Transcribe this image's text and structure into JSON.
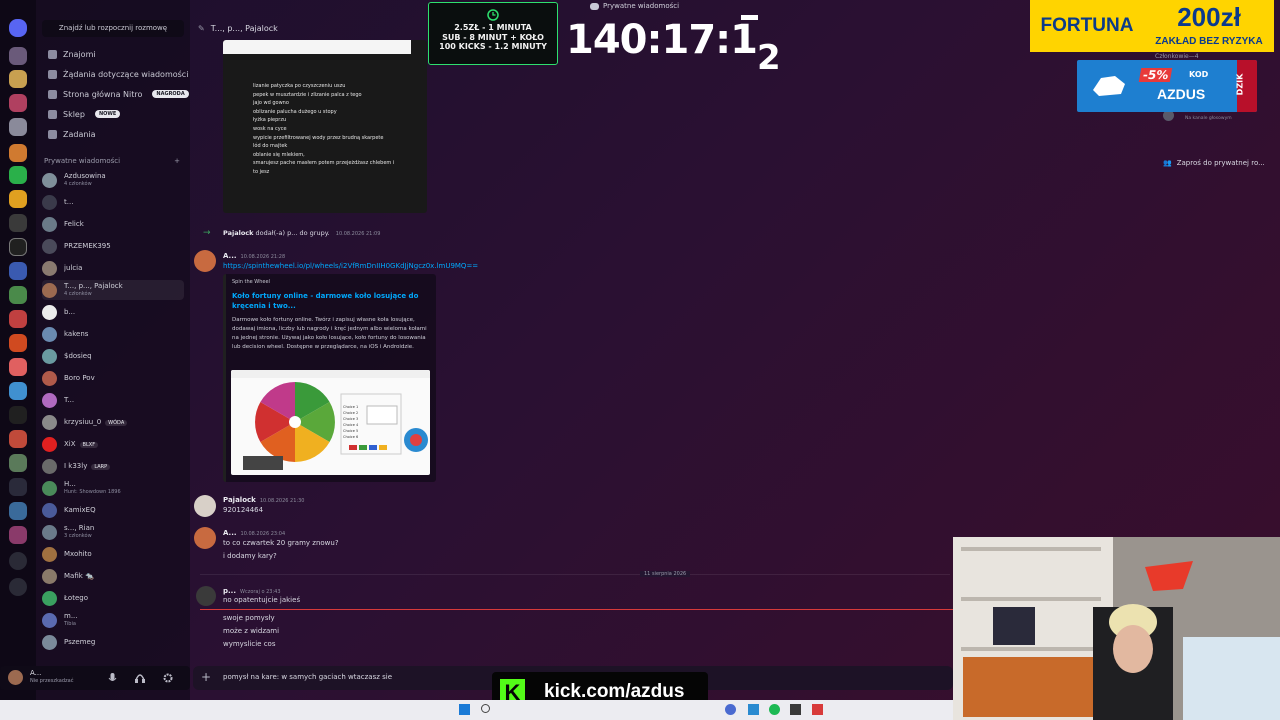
{
  "top_bar": {
    "title": "Prywatne wiadomości"
  },
  "dm_sidebar": {
    "search": "Znajdź lub rozpocznij rozmowę",
    "nav": [
      {
        "label": "Znajomi",
        "icon": "friends-icon",
        "badge": ""
      },
      {
        "label": "Żądania dotyczące wiadomości",
        "icon": "envelope-icon",
        "badge": ""
      },
      {
        "label": "Strona główna Nitro",
        "icon": "nitro-icon",
        "badge": "NAGRODA"
      },
      {
        "label": "Sklep",
        "icon": "shop-icon",
        "badge": "NOWE"
      },
      {
        "label": "Zadania",
        "icon": "tasks-icon",
        "badge": ""
      }
    ],
    "section_title": "Prywatne wiadomości",
    "section_add": "+",
    "dms": [
      {
        "name": "Azdusowina",
        "sub": "4 członków",
        "tag": "",
        "color": "#7f8f9a"
      },
      {
        "name": "t...",
        "sub": "",
        "tag": "",
        "color": "#3a3a4a"
      },
      {
        "name": "Felick",
        "sub": "",
        "tag": "",
        "color": "#6a7a88"
      },
      {
        "name": "PRZEMEK395",
        "sub": "",
        "tag": "",
        "color": "#4a4a5a"
      },
      {
        "name": "julcia",
        "sub": "",
        "tag": "",
        "color": "#8a7a70"
      },
      {
        "name": "T..., p..., Pajalock",
        "sub": "4 członków",
        "tag": "",
        "color": "#9c6a50",
        "selected": true
      },
      {
        "name": "b...",
        "sub": "",
        "tag": "",
        "color": "#ececec"
      },
      {
        "name": "kakens",
        "sub": "",
        "tag": "",
        "color": "#6a8ab0"
      },
      {
        "name": "$dosieq",
        "sub": "",
        "tag": "",
        "color": "#6a9aa0"
      },
      {
        "name": "Boro Pov",
        "sub": "",
        "tag": "",
        "color": "#b05a4a"
      },
      {
        "name": "T...",
        "sub": "",
        "tag": "",
        "color": "#b06ac0"
      },
      {
        "name": "krzysiuu_0",
        "sub": "",
        "tag": "WÓDA",
        "color": "#8a8a8a"
      },
      {
        "name": "XiX",
        "sub": "",
        "tag": "BLXF",
        "color": "#e02020"
      },
      {
        "name": "I k33ly",
        "sub": "",
        "tag": "LARP",
        "color": "#6a6a6a"
      },
      {
        "name": "H...",
        "sub": "Hunt: Showdown 1896",
        "tag": "",
        "color": "#4a8a5a"
      },
      {
        "name": "KamixEQ",
        "sub": "",
        "tag": "",
        "color": "#4a5a9a"
      },
      {
        "name": "s..., Rian",
        "sub": "3 członków",
        "tag": "",
        "color": "#6a7a8a"
      },
      {
        "name": "Mxohito",
        "sub": "",
        "tag": "",
        "color": "#a07040"
      },
      {
        "name": "Mafik 🐀",
        "sub": "",
        "tag": "",
        "color": "#8a7a6a"
      },
      {
        "name": "Łotego",
        "sub": "",
        "tag": "",
        "color": "#3aa060"
      },
      {
        "name": "m...",
        "sub": "Tibia",
        "tag": "",
        "color": "#5a6ab0"
      },
      {
        "name": "Pszemeg",
        "sub": "",
        "tag": "",
        "color": "#7a8a9a"
      }
    ],
    "user": {
      "name": "A...",
      "status": "Nie przeszkadzać"
    }
  },
  "chat": {
    "header_title": "T..., p..., Pajalock",
    "image_lines": [
      "lizanie patyczka po czyszczeniu uszu",
      "pepek w musztardzie i zlizanie palca z tego",
      "jajo wd gowno",
      "oblizanie palucha dużego u stopy",
      "łyżka pieprzu",
      "wosk na cyce",
      "wypicie przefiltrowanej wody przez brudną skarpete",
      "lód do majtek",
      "oblanie się mlekiem,",
      "smarujesz pache masłem potem przejeżdżasz chlebem i",
      "to jesz"
    ],
    "system_msg": {
      "actor": "Pajalock",
      "text": "dodał(-a) p...",
      "suffix": "do grupy.",
      "time": "10.08.2026 21:09"
    },
    "msg1": {
      "author": "A...",
      "time": "10.08.2026 21:28",
      "link": "https://spinthewheel.io/pl/wheels/i2VfRmDnIIH0GKdJjNgcz0x.lmU9MQ=="
    },
    "embed": {
      "provider": "Spin the Wheel",
      "title": "Koło fortuny online - darmowe koło losujące do kręcenia i two...",
      "description": "Darmowe koło fortuny online. Twórz i zapisuj własne koła losujące, dodawaj imiona, liczby lub nagrody i kręć jednym albo wieloma kołami na jednej stronie. Używaj jako koło losujące, koło fortuny do losowania lub decision wheel. Dostępne w przeglądarce, na iOS i Androidzie."
    },
    "wheel_choices": [
      "Choice 1",
      "Choice 2",
      "Choice 3",
      "Choice 4",
      "Choice 5",
      "Choice 6"
    ],
    "msg2": {
      "author": "Pajalock",
      "time": "10.08.2026 21:30",
      "text": "920124464"
    },
    "msg3": {
      "author": "A...",
      "time": "10.08.2026 23:04",
      "lines": [
        "to co czwartek 20 gramy znowu?",
        "i dodamy kary?"
      ]
    },
    "date_divider": "11 sierpnia 2026",
    "msg4": {
      "author": "p...",
      "time": "Wczoraj o 23:43",
      "lines": [
        "no opatentujcie jakieś",
        "swoje pomysły",
        "może z widzami",
        "wymyslicie cos"
      ]
    },
    "input_value": "pomysł na kare: w samych gaciach wtaczasz sie"
  },
  "right_panel": {
    "members_label": "Członkowie—4",
    "voice_label": "Na kanale głosowym",
    "invite": "Zaproś do prywatnej ro..."
  },
  "overlays": {
    "sub_box": [
      "2.5ZŁ - 1 MINUTA",
      "SUB - 8 MINUT + KOŁO",
      "100 KICKS - 1.2 MINUTY"
    ],
    "timer": "140:17:1",
    "timer_sub": "2",
    "fortuna_brand": "FORTUNA",
    "fortuna_amount": "200zł",
    "fortuna_text": "ZAKŁAD BEZ RYZYKA",
    "dzik_discount": "-5%",
    "dzik_kod": "KOD",
    "dzik_code": "AZDUS",
    "dzik_brand": "DZIK",
    "kick_url": "kick.com/azdus",
    "kick_logo": "K"
  }
}
